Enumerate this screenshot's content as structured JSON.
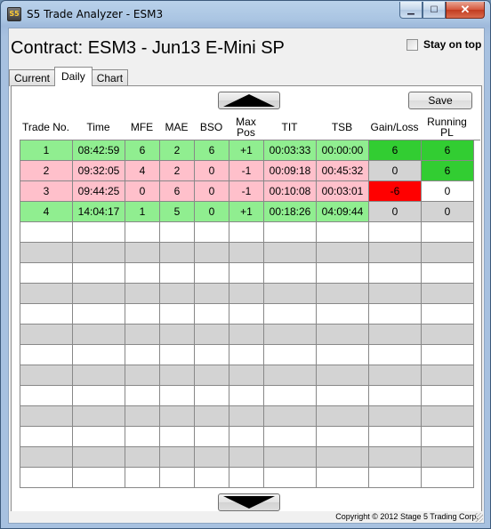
{
  "window": {
    "title": "S5 Trade Analyzer - ESM3",
    "app_icon_text": "S5",
    "min_label": "▁",
    "max_label": "☐",
    "close_label": "✕"
  },
  "contract": "Contract: ESM3 - Jun13 E-Mini SP",
  "stay_on_top": {
    "label": "Stay on top",
    "checked": false
  },
  "tabs": [
    {
      "label": "Current",
      "active": false
    },
    {
      "label": "Daily",
      "active": true
    },
    {
      "label": "Chart",
      "active": false
    }
  ],
  "save_label": "Save",
  "columns": [
    "Trade No.",
    "Time",
    "MFE",
    "MAE",
    "BSO",
    "Max Pos",
    "TIT",
    "TSB",
    "Gain/Loss",
    "Running PL"
  ],
  "trades": [
    {
      "cells": [
        "1",
        "08:42:59",
        "6",
        "2",
        "6",
        "+1",
        "00:03:33",
        "00:00:00",
        "6",
        "6"
      ],
      "row": "green",
      "gain_color": "green",
      "pl_color": "green"
    },
    {
      "cells": [
        "2",
        "09:32:05",
        "4",
        "2",
        "0",
        "-1",
        "00:09:18",
        "00:45:32",
        "0",
        "6"
      ],
      "row": "pink",
      "gain_color": "gray",
      "pl_color": "green"
    },
    {
      "cells": [
        "3",
        "09:44:25",
        "0",
        "6",
        "0",
        "-1",
        "00:10:08",
        "00:03:01",
        "-6",
        "0"
      ],
      "row": "pink",
      "gain_color": "red",
      "pl_color": "white"
    },
    {
      "cells": [
        "4",
        "14:04:17",
        "1",
        "5",
        "0",
        "+1",
        "00:18:26",
        "04:09:44",
        "0",
        "0"
      ],
      "row": "green",
      "gain_color": "gray",
      "pl_color": "gray"
    }
  ],
  "empty_rows": 13,
  "colors": {
    "win_row": "#90ee90",
    "loss_row": "#ffc0cb",
    "positive": "#32cd32",
    "negative": "#ff0000",
    "neutral": "#d3d3d3"
  },
  "footer": "Copyright © 2012 Stage 5 Trading Corp."
}
